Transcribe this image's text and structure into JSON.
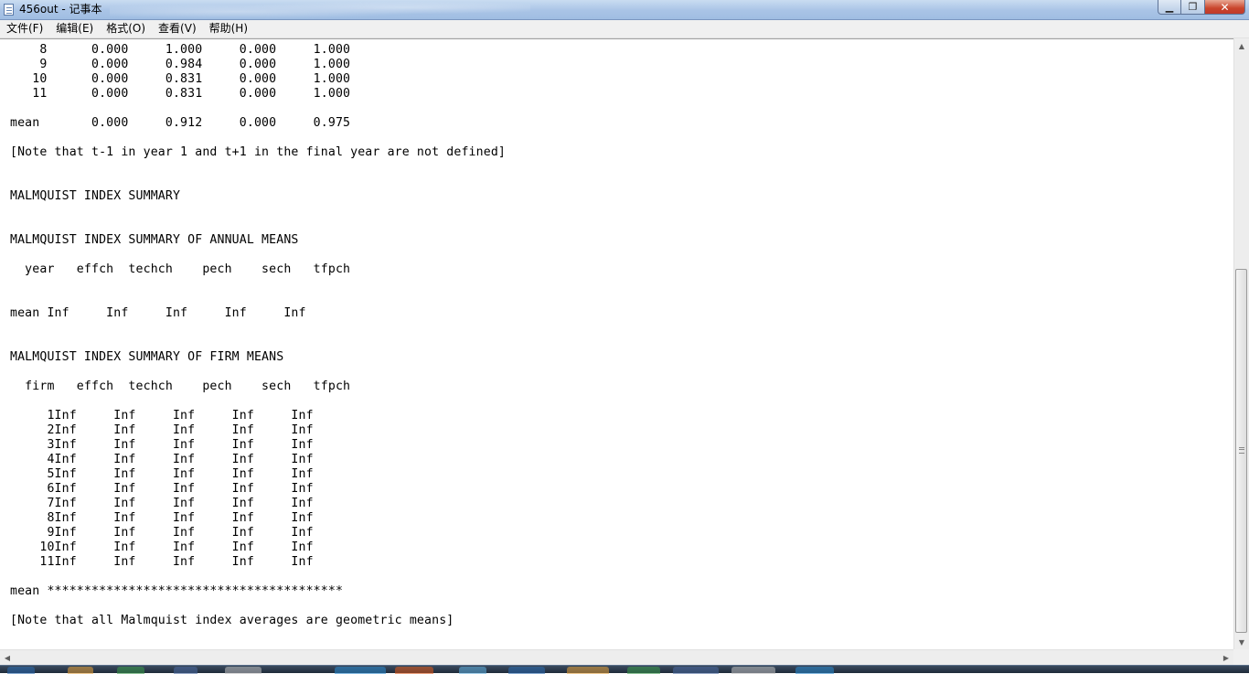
{
  "window": {
    "title": "456out - 记事本",
    "minimize_label": "▁",
    "maximize_label": "❐",
    "close_label": "✕",
    "icon": "notepad-icon"
  },
  "menu": {
    "items": [
      {
        "label": "文件(F)",
        "name": "menu-file"
      },
      {
        "label": "编辑(E)",
        "name": "menu-edit"
      },
      {
        "label": "格式(O)",
        "name": "menu-format"
      },
      {
        "label": "查看(V)",
        "name": "menu-view"
      },
      {
        "label": "帮助(H)",
        "name": "menu-help"
      }
    ]
  },
  "document": {
    "lines": [
      "    8      0.000     1.000     0.000     1.000",
      "    9      0.000     0.984     0.000     1.000",
      "   10      0.000     0.831     0.000     1.000",
      "   11      0.000     0.831     0.000     1.000",
      "",
      "mean       0.000     0.912     0.000     0.975",
      "",
      "[Note that t-1 in year 1 and t+1 in the final year are not defined]",
      "",
      "",
      "MALMQUIST INDEX SUMMARY",
      "",
      "",
      "MALMQUIST INDEX SUMMARY OF ANNUAL MEANS",
      "",
      "  year   effch  techch    pech    sech   tfpch",
      "",
      "",
      "mean Inf     Inf     Inf     Inf     Inf",
      "",
      "",
      "MALMQUIST INDEX SUMMARY OF FIRM MEANS",
      "",
      "  firm   effch  techch    pech    sech   tfpch",
      "",
      "     1Inf     Inf     Inf     Inf     Inf",
      "     2Inf     Inf     Inf     Inf     Inf",
      "     3Inf     Inf     Inf     Inf     Inf",
      "     4Inf     Inf     Inf     Inf     Inf",
      "     5Inf     Inf     Inf     Inf     Inf",
      "     6Inf     Inf     Inf     Inf     Inf",
      "     7Inf     Inf     Inf     Inf     Inf",
      "     8Inf     Inf     Inf     Inf     Inf",
      "     9Inf     Inf     Inf     Inf     Inf",
      "    10Inf     Inf     Inf     Inf     Inf",
      "    11Inf     Inf     Inf     Inf     Inf",
      "",
      "mean ****************************************",
      "",
      "[Note that all Malmquist index averages are geometric means]"
    ]
  },
  "scrollbars": {
    "vertical_position_fraction": 0.38,
    "up_arrow": "▲",
    "down_arrow": "▼",
    "left_arrow": "◀",
    "right_arrow": "▶"
  },
  "taskbar": {
    "colors": [
      "#2b6cb0",
      "#e8a23a",
      "#3a9a4a",
      "#4a6aa0",
      "#c0c0c0",
      "#2a8ad0",
      "#e05a1a",
      "#60b0e0"
    ]
  }
}
